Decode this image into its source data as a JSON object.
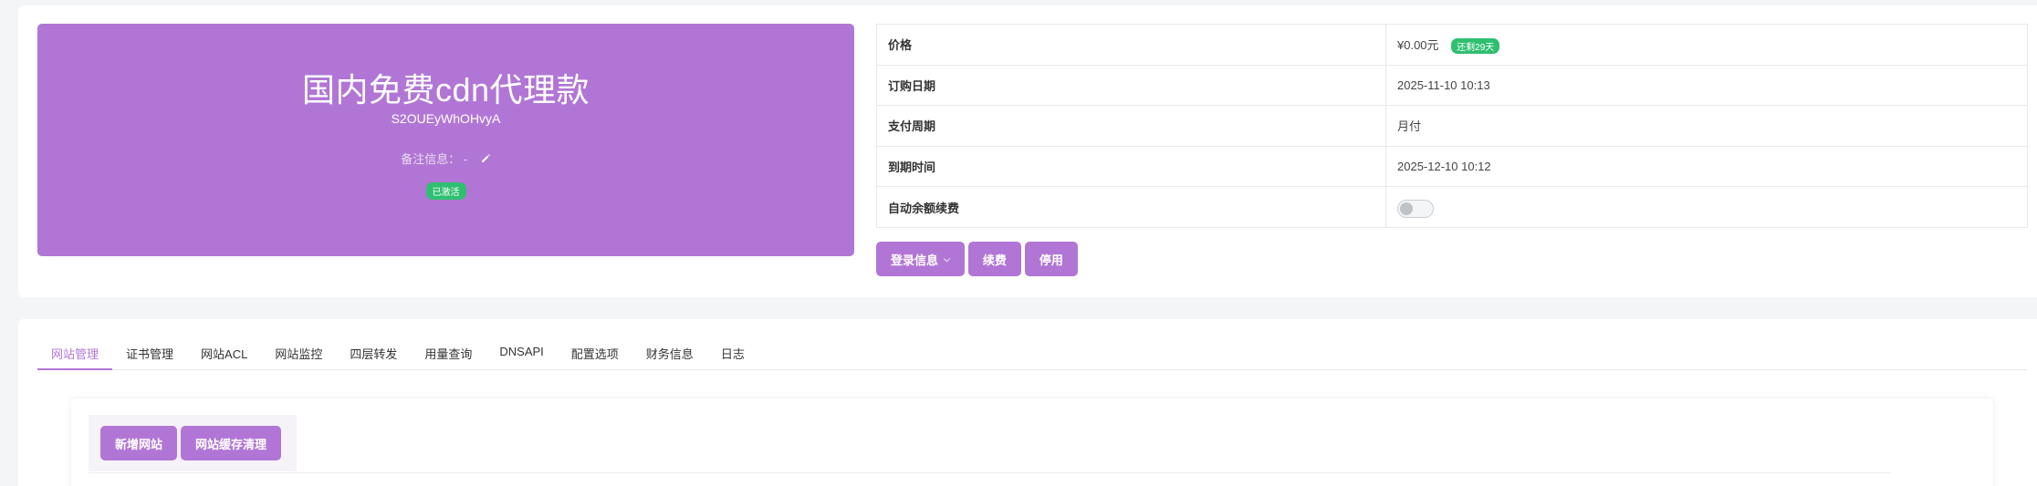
{
  "product": {
    "title": "国内免费cdn代理款",
    "code": "S2OUEyWhOHvyA",
    "remark_label": "备注信息：",
    "remark_value": "-",
    "edit_icon": "pencil-icon",
    "status": "已激活"
  },
  "info": {
    "rows": [
      {
        "key": "价格",
        "value": "¥0.00元",
        "badge": "还剩29天"
      },
      {
        "key": "订购日期",
        "value": "2025-11-10 10:13"
      },
      {
        "key": "支付周期",
        "value": "月付"
      },
      {
        "key": "到期时间",
        "value": "2025-12-10 10:12"
      },
      {
        "key": "自动余额续费",
        "toggle_on": false
      }
    ]
  },
  "actions": {
    "login_info": "登录信息",
    "renew": "续费",
    "disable": "停用"
  },
  "tabs": [
    "网站管理",
    "证书管理",
    "网站ACL",
    "网站监控",
    "四层转发",
    "用量查询",
    "DNSAPI",
    "配置选项",
    "财务信息",
    "日志"
  ],
  "active_tab": "网站管理",
  "toolbar": {
    "add_site": "新增网站",
    "clear_cache": "网站缓存清理"
  },
  "colors": {
    "accent": "#b176d5",
    "success": "#2fbf71"
  }
}
